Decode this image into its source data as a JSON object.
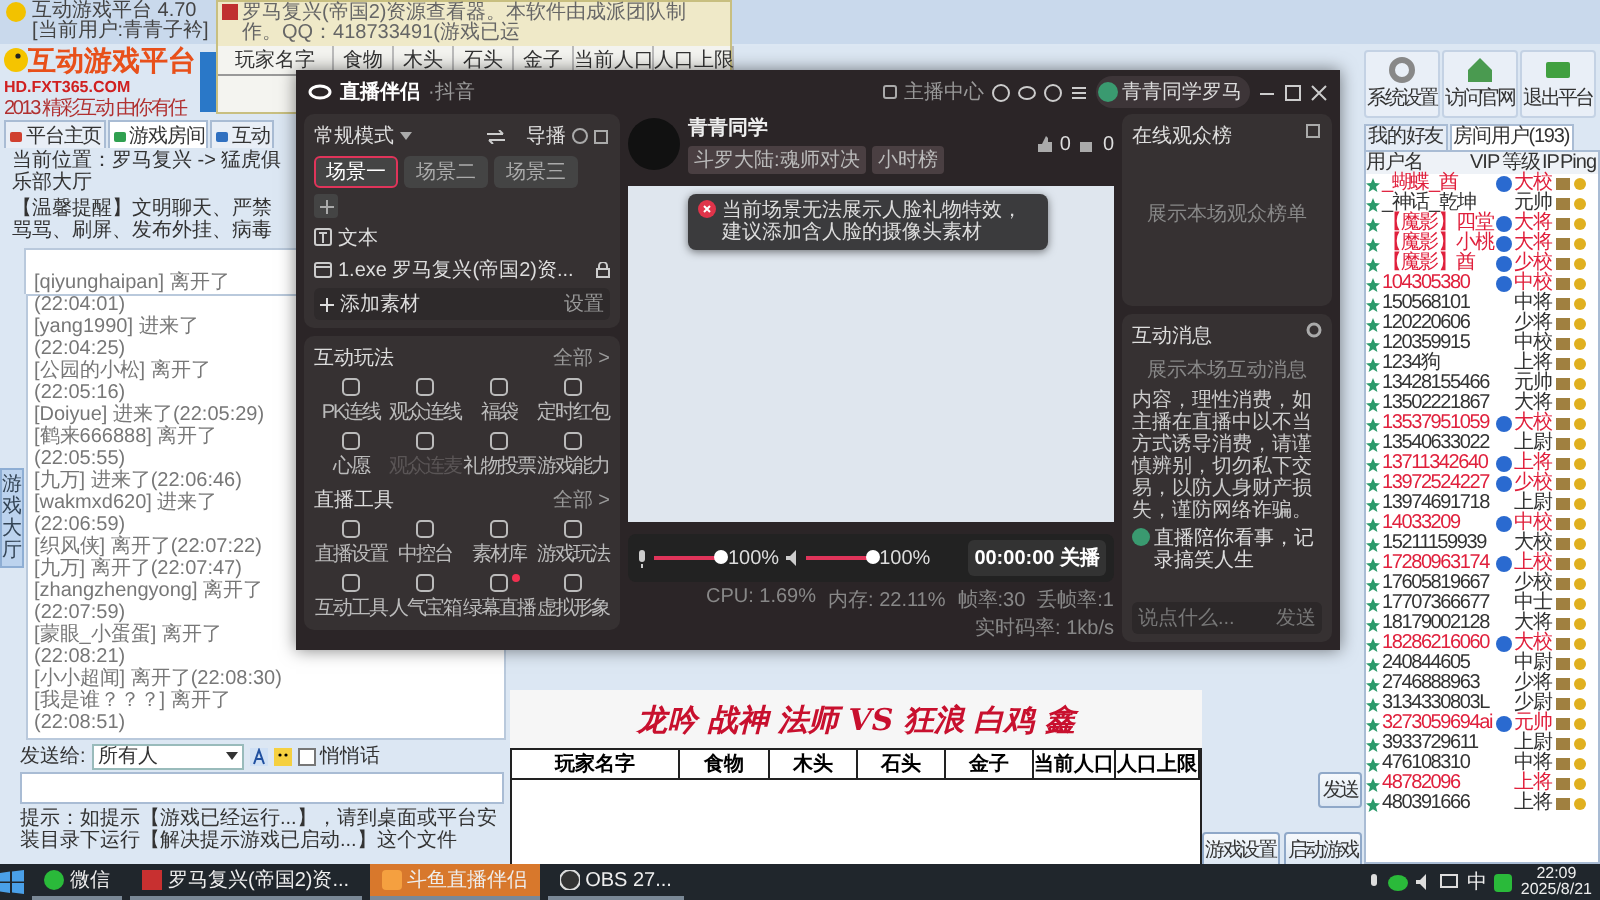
{
  "hall": {
    "title": "互动游戏平台 4.70 [当前用户:青青子衿]",
    "logo": {
      "name": "互动游戏平台",
      "url": "HD.FXT365.COM",
      "slogan": "2013 精彩互动 由你有任"
    },
    "tabs": [
      {
        "label": "平台主页",
        "selected": false
      },
      {
        "label": "游戏房间",
        "selected": true
      },
      {
        "label": "互动",
        "selected": false
      }
    ],
    "breadcrumb": "当前位置：罗马复兴 -> 猛虎俱乐部大厅",
    "notice": "【温馨提醒】文明聊天、严禁骂骂、刷屏、发布外挂、病毒",
    "side_tab": "游戏大厅",
    "chat_log": [
      "[qiyunghaipan] 离开了(22:04:01)",
      "[yang1990] 进来了(22:04:25)",
      "[公园的小松] 离开了(22:05:16)",
      "[Doiyue] 进来了(22:05:29)",
      "[鹤来666888] 离开了(22:05:55)",
      "[九万] 进来了(22:06:46)",
      "[wakmxd620] 进来了(22:06:59)",
      "[织风侠] 离开了(22:07:22)",
      "[九万] 离开了(22:07:47)",
      "[zhangzhengyong] 离开了(22:07:59)",
      "[蒙眼_小蛋蛋] 离开了(22:08:21)",
      "[小小超闻] 离开了(22:08:30)",
      "[我是谁？？？] 离开了(22:08:51)"
    ],
    "send_to": {
      "label": "发送给:",
      "value": "所有人"
    },
    "whisper": {
      "label": "悄悄话",
      "checked": false
    },
    "tip": "提示：如提示【游戏已经运行...】，请到桌面或平台安装目录下运行【解决提示游戏已启动...】这个文件",
    "send_button": "发送",
    "game_buttons": [
      "游戏设置",
      "启动游戏"
    ],
    "toolbar": [
      "系统设置",
      "访问官网",
      "退出平台"
    ],
    "user_tabs": [
      {
        "label": "我的好友",
        "selected": false
      },
      {
        "label": "房间用户(193)",
        "selected": true
      }
    ],
    "user_columns": [
      "用户名",
      "VIP",
      "等级",
      "IP",
      "Ping"
    ],
    "users": [
      {
        "name": "_蝴蝶_酋",
        "rank": "大校",
        "vip": true,
        "color": "#e0203c"
      },
      {
        "name": "_神话_乾坤",
        "rank": "元帅",
        "vip": false,
        "color": "#333333"
      },
      {
        "name": "【魔影】四堂",
        "rank": "大将",
        "vip": true,
        "color": "#e0203c"
      },
      {
        "name": "【魔影】小桃",
        "rank": "大将",
        "vip": true,
        "color": "#e0203c"
      },
      {
        "name": "【魔影】酋",
        "rank": "少校",
        "vip": true,
        "color": "#e0203c"
      },
      {
        "name": "104305380",
        "rank": "中校",
        "vip": true,
        "color": "#e0203c"
      },
      {
        "name": "150568101",
        "rank": "中将",
        "vip": false,
        "color": "#333333"
      },
      {
        "name": "120220606",
        "rank": "少将",
        "vip": false,
        "color": "#333333"
      },
      {
        "name": "120359915",
        "rank": "中校",
        "vip": false,
        "color": "#333333"
      },
      {
        "name": "1234狗",
        "rank": "上将",
        "vip": false,
        "color": "#333333"
      },
      {
        "name": "13428155466",
        "rank": "元帅",
        "vip": false,
        "color": "#333333"
      },
      {
        "name": "13502221867",
        "rank": "大将",
        "vip": false,
        "color": "#333333"
      },
      {
        "name": "13537951059",
        "rank": "大校",
        "vip": true,
        "color": "#e0203c"
      },
      {
        "name": "13540633022",
        "rank": "上尉",
        "vip": false,
        "color": "#333333"
      },
      {
        "name": "13711342640",
        "rank": "上将",
        "vip": true,
        "color": "#e0203c"
      },
      {
        "name": "13972524227",
        "rank": "少校",
        "vip": true,
        "color": "#e0203c"
      },
      {
        "name": "13974691718",
        "rank": "上尉",
        "vip": false,
        "color": "#333333"
      },
      {
        "name": "14033209",
        "rank": "中校",
        "vip": true,
        "color": "#e0203c"
      },
      {
        "name": "15211159939",
        "rank": "大校",
        "vip": false,
        "color": "#333333"
      },
      {
        "name": "17280963174",
        "rank": "上校",
        "vip": true,
        "color": "#e0203c"
      },
      {
        "name": "17605819667",
        "rank": "少校",
        "vip": false,
        "color": "#333333"
      },
      {
        "name": "17707366677",
        "rank": "中士",
        "vip": false,
        "color": "#333333"
      },
      {
        "name": "18179002128",
        "rank": "大将",
        "vip": false,
        "color": "#333333"
      },
      {
        "name": "18286216060",
        "rank": "大校",
        "vip": true,
        "color": "#e0203c"
      },
      {
        "name": "240844605",
        "rank": "中尉",
        "vip": false,
        "color": "#333333"
      },
      {
        "name": "2746888963",
        "rank": "少将",
        "vip": false,
        "color": "#333333"
      },
      {
        "name": "3134330803L",
        "rank": "少尉",
        "vip": false,
        "color": "#333333"
      },
      {
        "name": "3273059694ai",
        "rank": "元帅",
        "vip": true,
        "color": "#e0203c"
      },
      {
        "name": "3933729611",
        "rank": "上尉",
        "vip": false,
        "color": "#333333"
      },
      {
        "name": "476108310",
        "rank": "中将",
        "vip": false,
        "color": "#333333"
      },
      {
        "name": "48782096",
        "rank": "上将",
        "vip": false,
        "color": "#e0203c"
      },
      {
        "name": "480391666",
        "rank": "上将",
        "vip": false,
        "color": "#333333"
      }
    ]
  },
  "resource_viewer": {
    "title": "罗马复兴(帝国2)资源查看器。本软件由成派团队制作。QQ：418733491(游戏已运",
    "columns": [
      "玩家名字",
      "食物",
      "木头",
      "石头",
      "金子",
      "当前人口",
      "人口上限"
    ]
  },
  "scoreboard": {
    "title": "龙吟 战神 法师 VS 狂浪 白鸡 鑫",
    "columns": [
      "玩家名字",
      "食物",
      "木头",
      "石头",
      "金子",
      "当前人口",
      "人口上限"
    ]
  },
  "stream": {
    "app": "直播伴侣",
    "platform": "·抖音",
    "creator_center": "主播中心",
    "account": "青青同学罗马",
    "toast": "当前场景无法展示人脸礼物特效，建议添加含人脸的摄像头素材",
    "mode": "常规模式",
    "director": "导播",
    "scenes": [
      {
        "label": "场景一",
        "selected": true
      },
      {
        "label": "场景二",
        "selected": false
      },
      {
        "label": "场景三",
        "selected": false
      }
    ],
    "sources": [
      {
        "kind": "text",
        "label": "文本",
        "locked": false
      },
      {
        "kind": "window",
        "label": "1.exe 罗马复兴(帝国2)资...",
        "locked": true
      }
    ],
    "add_source": "添加素材",
    "source_settings": "设置",
    "sections": [
      {
        "title": "互动玩法",
        "more": "全部 >",
        "items": [
          {
            "label": "PK连线",
            "disabled": false,
            "badge": false
          },
          {
            "label": "观众连线",
            "disabled": false,
            "badge": false
          },
          {
            "label": "福袋",
            "disabled": false,
            "badge": false
          },
          {
            "label": "定时红包",
            "disabled": false,
            "badge": false
          },
          {
            "label": "心愿",
            "disabled": false,
            "badge": false
          },
          {
            "label": "观众连麦",
            "disabled": true,
            "badge": false
          },
          {
            "label": "礼物投票",
            "disabled": false,
            "badge": false
          },
          {
            "label": "游戏能力",
            "disabled": false,
            "badge": false
          }
        ]
      },
      {
        "title": "直播工具",
        "more": "全部 >",
        "items": [
          {
            "label": "直播设置",
            "disabled": false,
            "badge": false
          },
          {
            "label": "中控台",
            "disabled": false,
            "badge": false
          },
          {
            "label": "素材库",
            "disabled": false,
            "badge": false
          },
          {
            "label": "游戏玩法",
            "disabled": false,
            "badge": false
          },
          {
            "label": "互动工具",
            "disabled": false,
            "badge": false
          },
          {
            "label": "人气宝箱",
            "disabled": false,
            "badge": false
          },
          {
            "label": "绿幕直播",
            "disabled": false,
            "badge": true
          },
          {
            "label": "虚拟形象",
            "disabled": false,
            "badge": false
          }
        ]
      }
    ],
    "streamer": {
      "name": "青青同学",
      "tags": [
        "斗罗大陆:魂师对决",
        "小时榜"
      ],
      "likes": "0",
      "gifts": "0"
    },
    "mic": {
      "level": 1,
      "reading": "100%"
    },
    "speaker": {
      "level": 1,
      "reading": "100%"
    },
    "timer": "00:00:00",
    "stop": "关播",
    "stats": [
      "CPU: 1.69%",
      "内存: 22.11%",
      "帧率:30",
      "丢帧率:1",
      "实时码率: 1kb/s"
    ],
    "viewers": {
      "title": "在线观众榜",
      "empty": "展示本场观众榜单"
    },
    "messages": {
      "title": "互动消息",
      "empty": "展示本场互动消息",
      "notice": "内容，理性消费，如主播在直播中以不当方式诱导消费，请谨慎辨别，切勿私下交易，以防人身财产损失，谨防网络诈骗。",
      "message": "直播陪你看事，记录搞笑人生",
      "placeholder": "说点什么...",
      "send": "发送"
    }
  },
  "taskbar": {
    "items": [
      {
        "label": "微信",
        "selected": false
      },
      {
        "label": "罗马复兴(帝国2)资...",
        "selected": false
      },
      {
        "label": "斗鱼直播伴侣",
        "selected": true
      },
      {
        "label": "OBS 27...",
        "selected": false
      }
    ],
    "ime": "中",
    "time": "22:09",
    "date": "2025/8/21"
  }
}
